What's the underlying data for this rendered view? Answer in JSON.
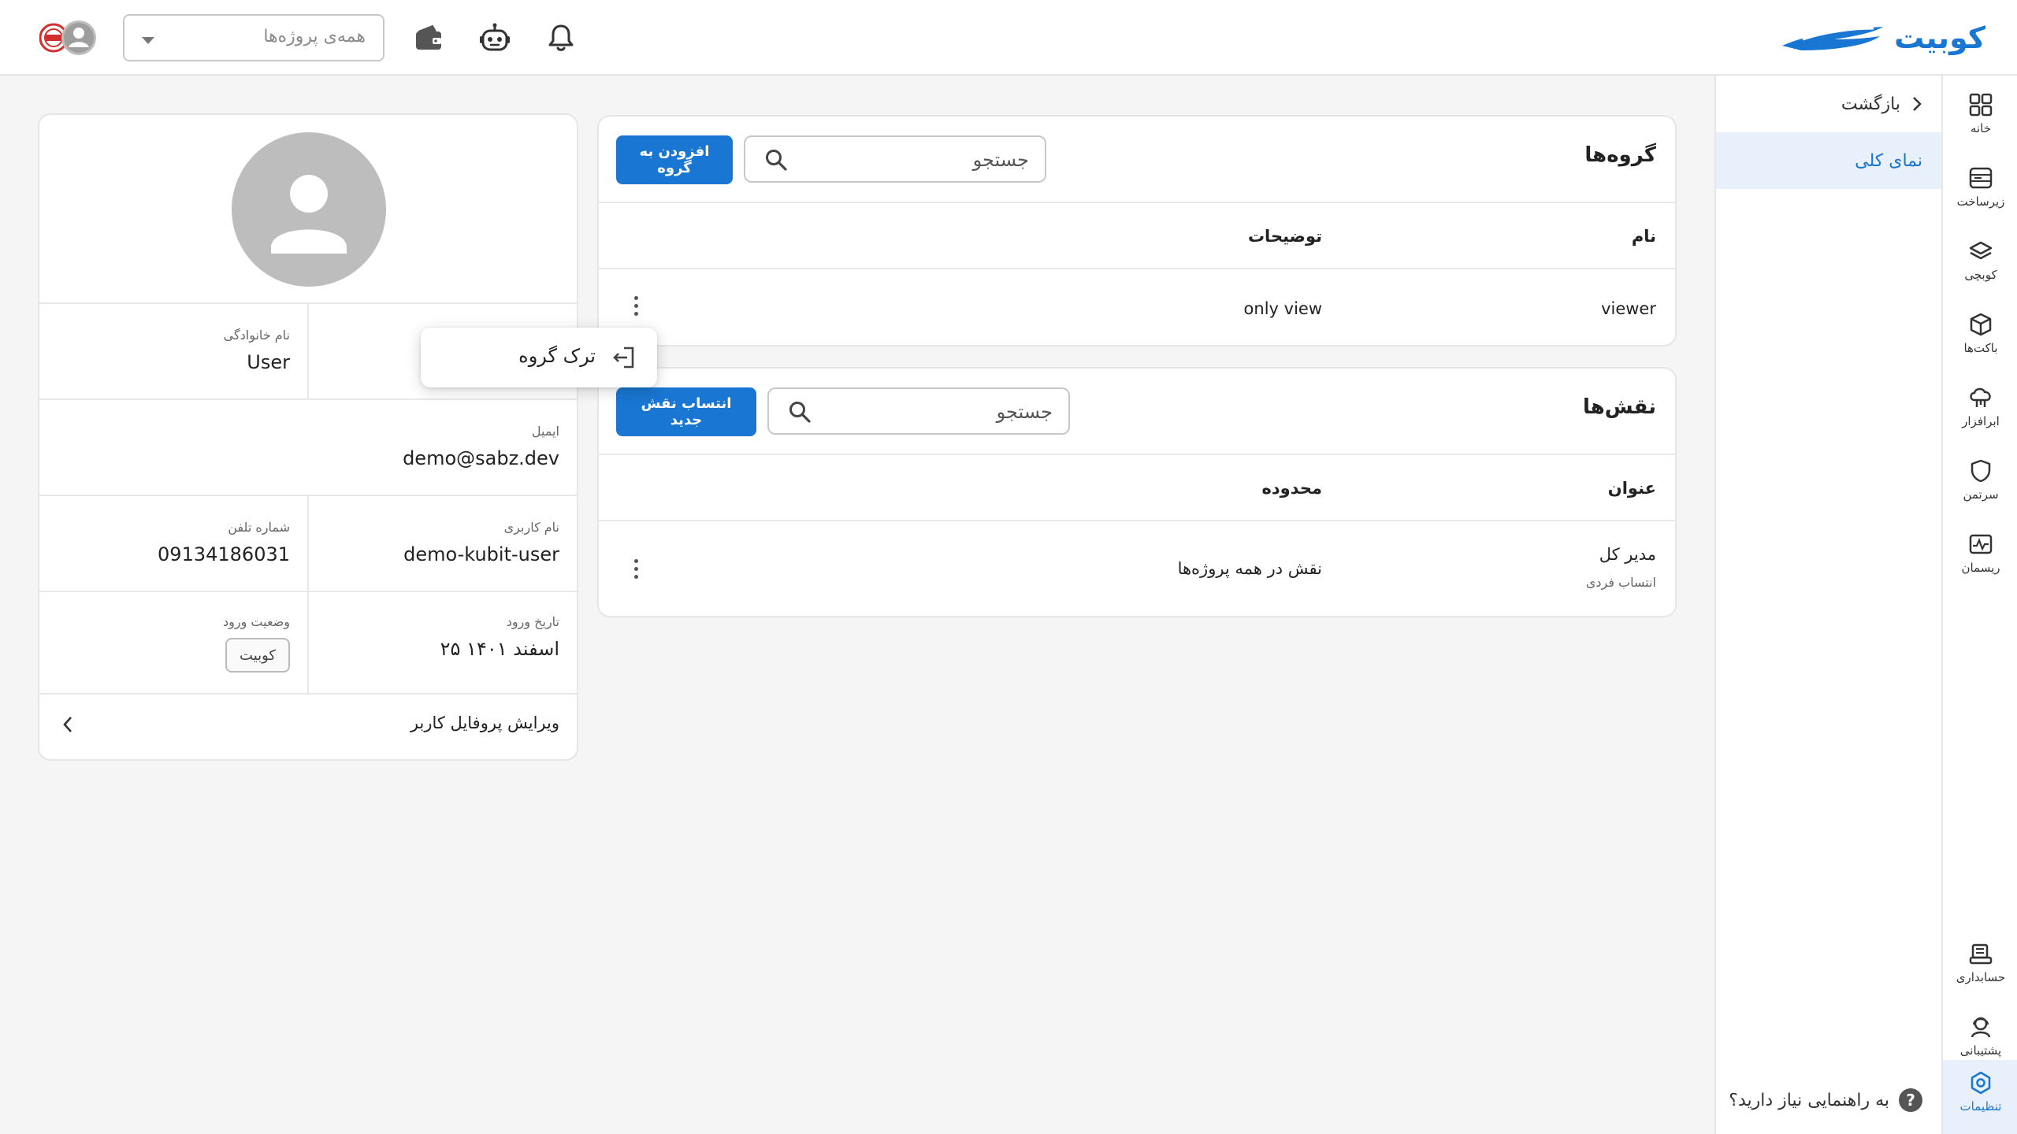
{
  "app": {
    "logo_text": "کوبیت",
    "brand_color": "#1976d2"
  },
  "topbar": {
    "project_select_placeholder": "همه‌ی پروژه‌ها",
    "icons": [
      "bell-icon",
      "robot-icon",
      "wallet-icon"
    ]
  },
  "rail": {
    "top_items": [
      {
        "label": "خانه",
        "icon": "grid-icon"
      },
      {
        "label": "زیرساخت",
        "icon": "server-icon"
      },
      {
        "label": "کوبچی",
        "icon": "layers-icon"
      },
      {
        "label": "باکت‌ها",
        "icon": "cube-icon"
      },
      {
        "label": "ابرافزار",
        "icon": "cloud-app-icon"
      },
      {
        "label": "سرتمن",
        "icon": "shield-icon"
      },
      {
        "label": "ریسمان",
        "icon": "pulse-icon"
      }
    ],
    "bottom_items": [
      {
        "label": "حسابداری",
        "icon": "accounting-icon"
      },
      {
        "label": "پشتیبانی",
        "icon": "support-icon"
      },
      {
        "label": "تنظیمات",
        "icon": "settings-icon"
      }
    ]
  },
  "subnav": {
    "back_label": "بازگشت",
    "overview_label": "نمای کلی",
    "help_text": "به راهنمایی نیاز دارید؟",
    "help_mark": "?"
  },
  "groups": {
    "title": "گروه‌ها",
    "search_placeholder": "جستجو",
    "add_button": "افزودن به گروه",
    "columns": {
      "name": "نام",
      "description": "توضیحات"
    },
    "rows": [
      {
        "name": "viewer",
        "description": "only view"
      }
    ]
  },
  "popup_menu": {
    "leave_group": "ترک گروه"
  },
  "roles": {
    "title": "نقش‌ها",
    "search_placeholder": "جستجو",
    "assign_button": "انتساب نقش جدید",
    "columns": {
      "title": "عنوان",
      "scope": "محدوده"
    },
    "rows": [
      {
        "title": "مدیر کل",
        "subtitle": "انتساب فردی",
        "scope": "نقش در همه پروژه‌ها"
      }
    ]
  },
  "profile": {
    "last_name_label": "نام خانوادگی",
    "last_name": "User",
    "email_label": "ایمیل",
    "email": "demo@sabz.dev",
    "username_label": "نام کاربری",
    "username": "demo-kubit-user",
    "phone_label": "شماره تلفن",
    "phone": "09134186031",
    "login_date_label": "تاریخ ورود",
    "login_date": "۲۵ اسفند ۱۴۰۱",
    "login_status_label": "وضعیت ورود",
    "login_status": "کوبیت",
    "edit_label": "ویرایش پروفایل کاربر"
  }
}
